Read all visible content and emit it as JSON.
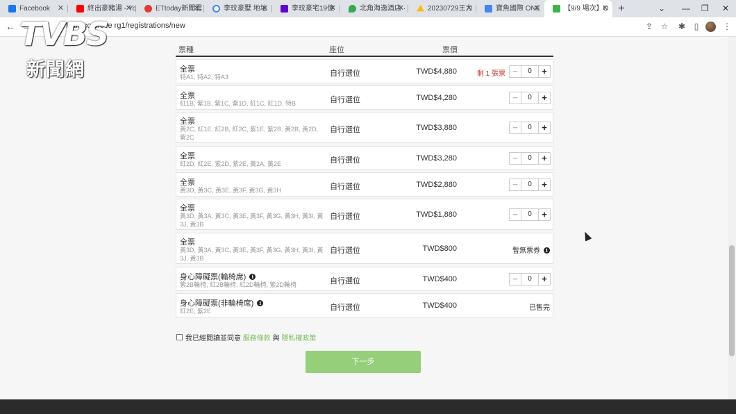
{
  "browser": {
    "tabs": [
      {
        "title": "Facebook",
        "color": "#1877f2"
      },
      {
        "title": "終出豪豬湯 - Yo",
        "color": "#ff0000"
      },
      {
        "title": "ETtoday新聞雲",
        "color": "#e53935"
      },
      {
        "title": "李玟豪墅 地址",
        "color": "#4285f4"
      },
      {
        "title": "李玟豪宅19億",
        "color": "#6001d2"
      },
      {
        "title": "北角海逸酒店 ·",
        "color": "#34a853"
      },
      {
        "title": "20230729王力",
        "color": "#fbbc04"
      },
      {
        "title": "寶魚國際 ONE",
        "color": "#4285f4"
      },
      {
        "title": "【9/9 場次】O",
        "color": "#3bb54a",
        "active": true
      }
    ],
    "new_tab": "+",
    "url": "kktix.com/eve         rg1/registrations/new"
  },
  "watermark": {
    "logo": "TVBS",
    "sub": "新聞網"
  },
  "table": {
    "headers": {
      "type": "票種",
      "seat": "座位",
      "price": "票價"
    },
    "rows": [
      {
        "name": "全票",
        "seats": "特A1, 特A2, 特A3",
        "seat": "自行選位",
        "price": "TWD$4,880",
        "remaining": "剩 1 張票",
        "qty": "0"
      },
      {
        "name": "全票",
        "seats": "紅1B, 紫1B, 紫1C, 紫1D, 紅1C, 紅1D, 特B",
        "seat": "自行選位",
        "price": "TWD$4,280",
        "qty": "0"
      },
      {
        "name": "全票",
        "seats": "黃2C, 紅1E, 紅2B, 紅2C, 紫1E, 紫2B, 黃2B, 黃2D, 紫2C",
        "seat": "自行選位",
        "price": "TWD$3,880",
        "qty": "0"
      },
      {
        "name": "全票",
        "seats": "紅2D, 紅2E, 紫2D, 紫2E, 黃2A, 黃2E",
        "seat": "自行選位",
        "price": "TWD$3,280",
        "qty": "0"
      },
      {
        "name": "全票",
        "seats": "黃3D, 黃3C, 黃3E, 黃3F, 黃3G, 黃3H",
        "seat": "自行選位",
        "price": "TWD$2,880",
        "qty": "0"
      },
      {
        "name": "全票",
        "seats": "黃3D, 黃3A, 黃3C, 黃3E, 黃3F, 黃3G, 黃3H, 黃3I, 黃3J, 黃3B",
        "seat": "自行選位",
        "price": "TWD$1,880",
        "qty": "0"
      },
      {
        "name": "全票",
        "seats": "黃3D, 黃3A, 黃3C, 黃3E, 黃3F, 黃3G, 黃3H, 黃3I, 黃3J, 黃3B",
        "seat": "自行選位",
        "price": "TWD$800",
        "status": "暫無票券"
      },
      {
        "name": "身心障礙票(輪椅席)",
        "seats": "紫2B輪椅, 紅2B輪椅, 紅2D輪椅, 紫2D輪椅",
        "seat": "自行選位",
        "price": "TWD$400",
        "qty": "0"
      },
      {
        "name": "身心障礙票(非輪椅席)",
        "seats": "紅2E, 紫2E",
        "seat": "自行選位",
        "price": "TWD$400",
        "status": "已售完"
      }
    ]
  },
  "agreement": {
    "prefix": "我已經閱讀並同意",
    "terms": "服務條款",
    "and": "與",
    "privacy": "隱私權政策"
  },
  "next_button": "下一步",
  "colors": {
    "link": "#7dbf5c",
    "button": "#95cf79",
    "remaining": "#c0392b"
  }
}
